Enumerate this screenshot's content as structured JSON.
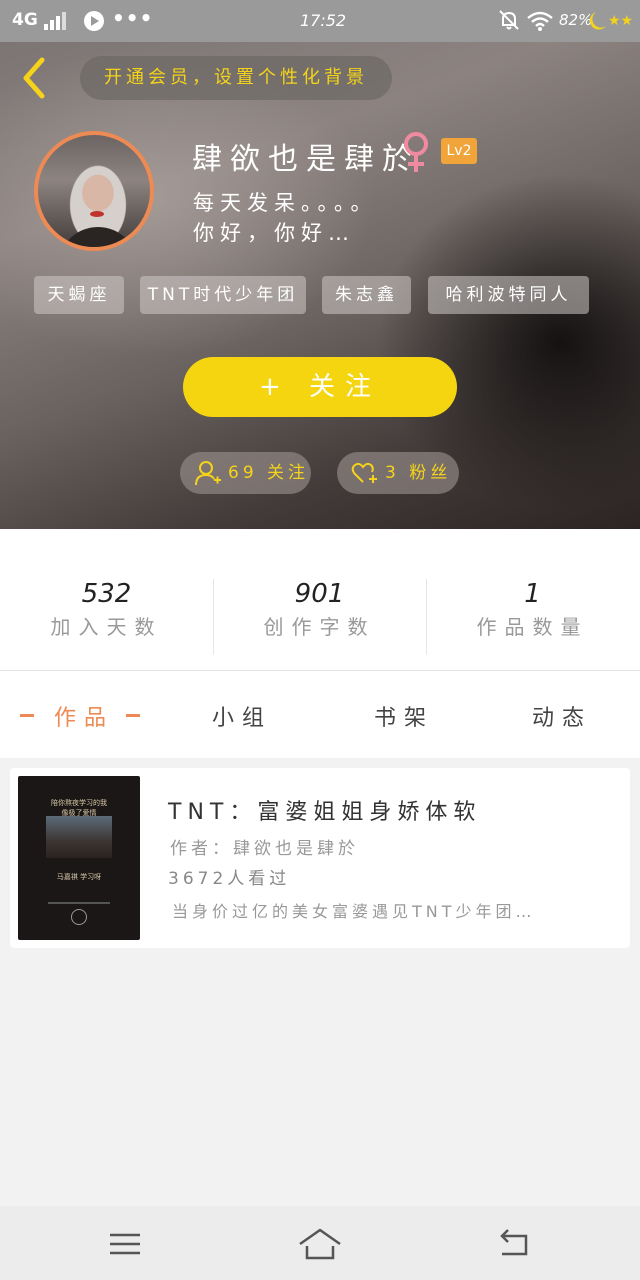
{
  "status_bar": {
    "network": "4G",
    "time": "17:52",
    "battery": "82%",
    "more": "•••",
    "icons": [
      "signal-icon",
      "app-notification-icon",
      "bell-muted-icon",
      "wifi-icon",
      "weather-moon-stars-icon"
    ]
  },
  "header": {
    "background_hint": "开通会员，设置个性化背景",
    "username": "肆欲也是肆於",
    "level": "Lv2",
    "bio_line1": "每天发呆。。。。",
    "bio_line2": "你好，你好…",
    "tags": [
      "天蝎座",
      "TNT时代少年团",
      "朱志鑫",
      "哈利波特同人"
    ],
    "follow_button": "+ 关注",
    "following_pill": "69 关注",
    "fans_pill": "3 粉丝",
    "accent_color": "#f5d50f",
    "avatar_ring_color": "#ee8a53"
  },
  "stats": [
    {
      "value": "532",
      "label": "加入天数"
    },
    {
      "value": "901",
      "label": "创作字数"
    },
    {
      "value": "1",
      "label": "作品数量"
    }
  ],
  "tabs": [
    {
      "label": "作品",
      "active": true
    },
    {
      "label": "小组",
      "active": false
    },
    {
      "label": "书架",
      "active": false
    },
    {
      "label": "动态",
      "active": false
    }
  ],
  "works": [
    {
      "title": "TNT：富婆姐姐身娇体软",
      "author": "作者：肆欲也是肆於",
      "views": "3672人看过",
      "description": "当身价过亿的美女富婆遇见TNT少年团…",
      "cover_text_1": "陪你熬夜学习的我",
      "cover_text_2": "像极了爱情",
      "cover_text_3": "马嘉祺 学习呀"
    }
  ],
  "nav": [
    "menu-icon",
    "home-icon",
    "back-icon"
  ]
}
